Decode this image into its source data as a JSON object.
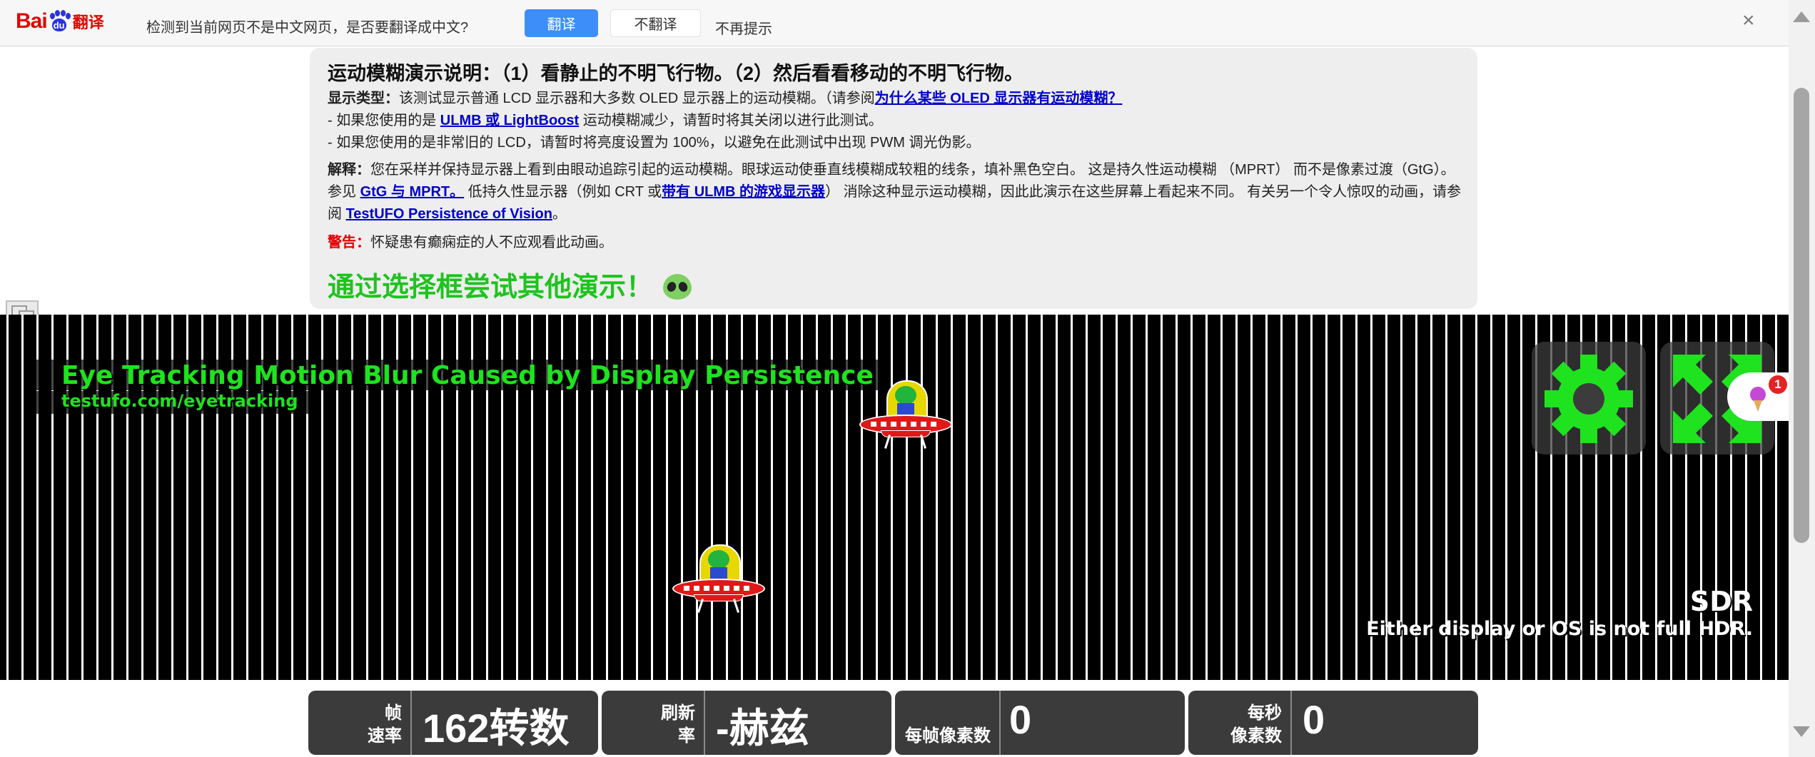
{
  "translate_bar": {
    "logo_bai": "Bai",
    "logo_du": "du",
    "logo_fanyi": "翻译",
    "message": "检测到当前网页不是中文网页，是否要翻译成中文?",
    "translate_button": "翻译",
    "no_translate_button": "不翻译",
    "no_remind": "不再提示",
    "close_glyph": "×"
  },
  "info": {
    "title": "运动模糊演示说明：（1）看静止的不明飞行物。（2）然后看看移动的不明飞行物。",
    "display_type": {
      "label": "显示类型：",
      "text": "该测试显示普通 LCD 显示器和大多数 OLED 显示器上的运动模糊。（请参阅",
      "link": "为什么某些 OLED 显示器有运动模糊？"
    },
    "line_ulmb": {
      "prefix": "- 如果您使用的是 ",
      "link": "ULMB 或 LightBoost",
      "suffix": " 运动模糊减少，请暂时将其关闭以进行此测试。"
    },
    "line_lcd": "- 如果您使用的是非常旧的 LCD，请暂时将亮度设置为 100%，以避免在此测试中出现 PWM 调光伪影。",
    "explain": {
      "label": "解释：",
      "text1": "您在采样并保持显示器上看到由眼动追踪引起的运动模糊。眼球运动使垂直线模糊成较粗的线条，填补黑色空白。 这是持久性运动模糊 （MPRT） 而不是像素过渡（GtG）。参见 ",
      "link1": "GtG 与 MPRT。",
      "text2": " 低持久性显示器（例如 CRT 或",
      "link2": "带有 ULMB 的游戏显示器",
      "text3": "） 消除这种显示运动模糊，因此此演示在这些屏幕上看起来不同。 有关另一个令人惊叹的动画，请参阅 ",
      "link3": "TestUFO Persistence of Vision",
      "text4": "。"
    },
    "warning": {
      "label": "警告：",
      "text": "怀疑患有癫痫症的人不应观看此动画。"
    },
    "cta": "通过选择框尝试其他演示！"
  },
  "canvas": {
    "title": "Eye Tracking Motion Blur Caused by Display Persistence",
    "url": "testufo.com/eyetracking",
    "sdr": "SDR",
    "sdr_note": "Either display or OS is not full HDR.",
    "accent_color": "#1ee31e",
    "notification_count": "1",
    "icons": [
      "settings-gear-icon",
      "fullscreen-icon",
      "ice-cream-icon"
    ]
  },
  "stats": [
    {
      "label_line1": "帧",
      "label_line2": "速率",
      "value": "162转数"
    },
    {
      "label_line1": "刷新",
      "label_line2": "率",
      "value": "-赫兹"
    },
    {
      "label_line1": "",
      "label_line2": "每帧像素数",
      "value": "0"
    },
    {
      "label_line1": "每秒",
      "label_line2": "像素数",
      "value": "0"
    }
  ]
}
